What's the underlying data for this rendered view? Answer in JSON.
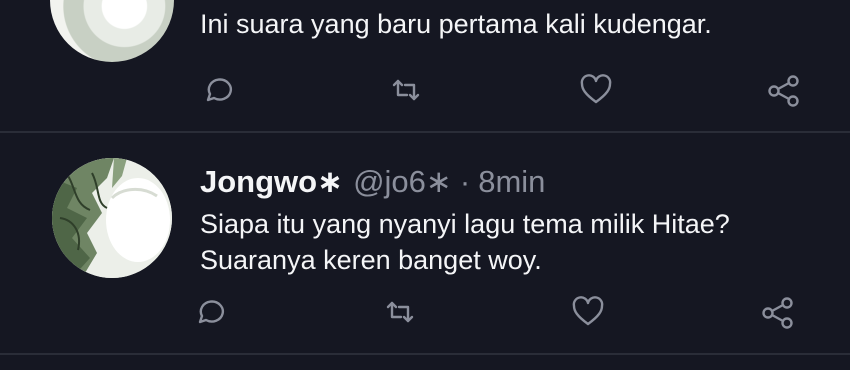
{
  "tweets": [
    {
      "avatar": "profile-photo",
      "text": "Ini suara yang baru pertama kali kudengar.",
      "actions": [
        "reply-icon",
        "retweet-icon",
        "like-icon",
        "share-icon"
      ]
    },
    {
      "avatar": "profile-photo",
      "display_name": "Jongwo∗",
      "handle": "@jo6∗",
      "separator": "·",
      "time": "8min",
      "text_line1": "Siapa itu yang nyanyi lagu tema milik Hitae?",
      "text_line2": "Suaranya keren banget woy.",
      "actions": [
        "reply-icon",
        "retweet-icon",
        "like-icon",
        "share-icon"
      ]
    }
  ],
  "colors": {
    "background": "#151722",
    "text": "#f4f5f7",
    "muted": "#8b8f9c",
    "divider": "#2a2d38"
  }
}
